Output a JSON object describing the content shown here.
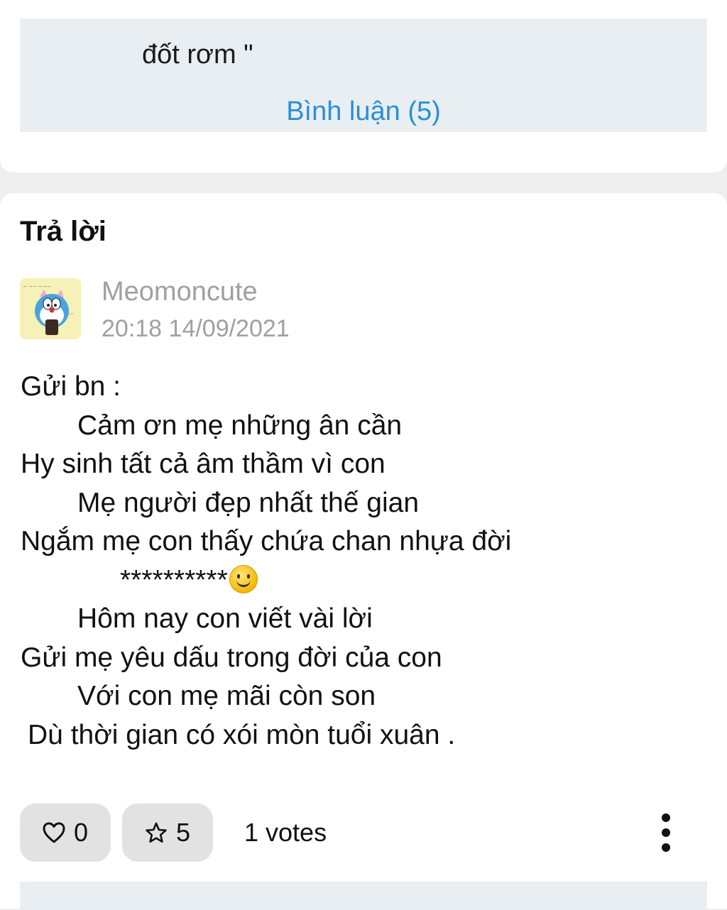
{
  "previous_post": {
    "text_tail": "đốt rơm \"",
    "comments_link": "Bình luận (5)"
  },
  "answer": {
    "heading": "Trả lời",
    "author": {
      "name": "Meomoncute",
      "timestamp": "20:18 14/09/2021",
      "avatar_icon": "doraemon-avatar"
    },
    "body_lines": [
      "Gửi bn :",
      "Cảm ơn mẹ những ân cần",
      "Hy sinh tất cả âm thầm vì con",
      "Mẹ người đẹp nhất thế gian",
      "Ngắm mẹ con thấy chứa chan nhựa đời",
      "**********",
      "Hôm nay con viết vài lời",
      "Gửi mẹ yêu dấu trong đời của con",
      "Với con mẹ mãi còn son",
      "Dù thời gian có xói mòn tuổi xuân ."
    ],
    "actions": {
      "likes": "0",
      "stars": "5",
      "votes": "1 votes"
    }
  },
  "colors": {
    "link": "#2b8fd6",
    "meta_gray": "#a0a0a0",
    "box_bg": "#e8eef2",
    "pill_bg": "#e2e2e2"
  }
}
